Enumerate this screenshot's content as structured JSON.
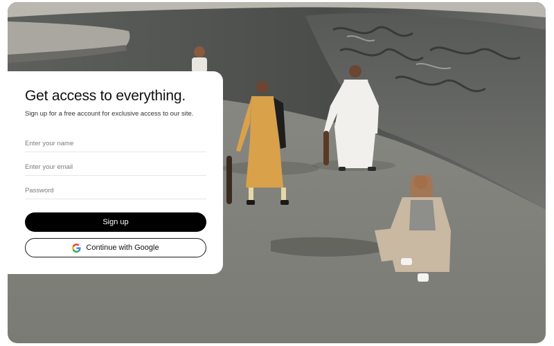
{
  "signup": {
    "title": "Get access to everything.",
    "subtitle": "Sign up for a free account for exclusive access to our site.",
    "name_placeholder": "Enter your name",
    "email_placeholder": "Enter your email",
    "password_placeholder": "Password",
    "signup_label": "Sign up",
    "google_label": "Continue with Google"
  },
  "icons": {
    "google": "google-g-icon"
  },
  "colors": {
    "primary_button": "#000000",
    "card_background": "#ffffff",
    "google_blue": "#4285F4",
    "google_red": "#EA4335",
    "google_yellow": "#FBBC05",
    "google_green": "#34A853"
  }
}
